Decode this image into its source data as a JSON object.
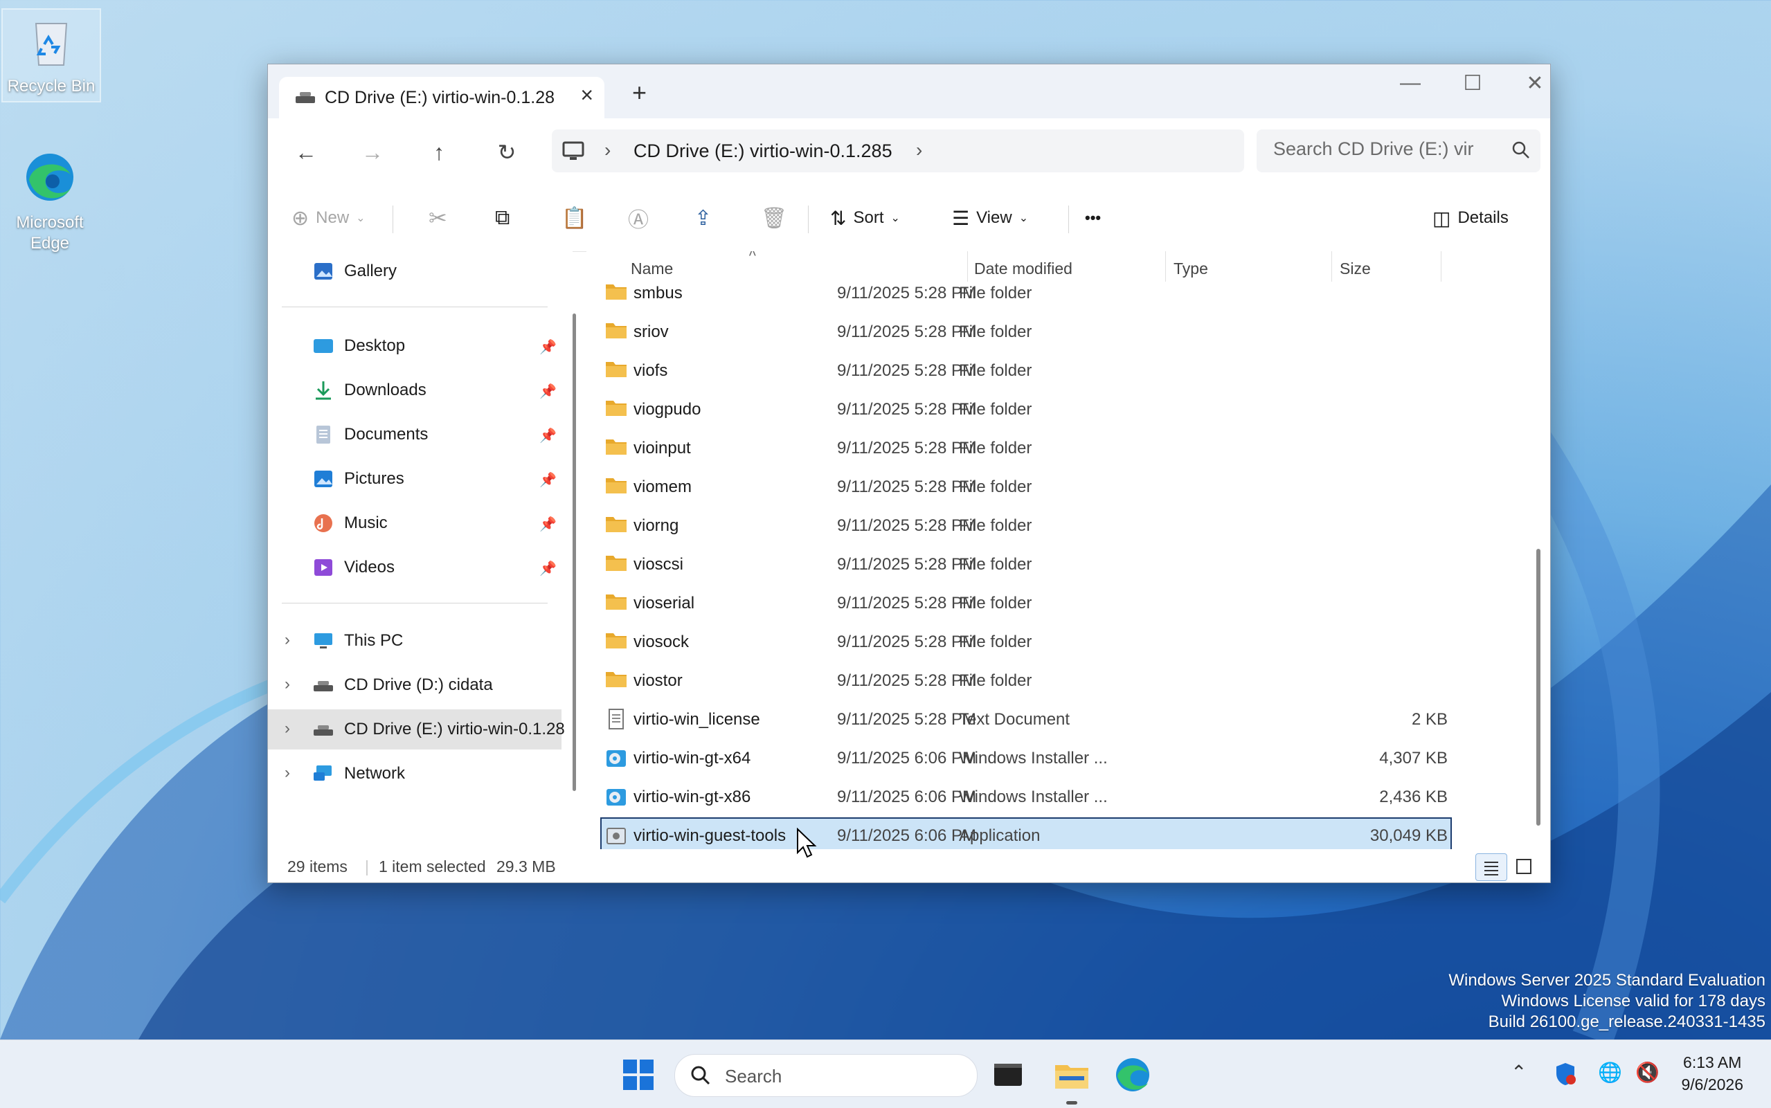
{
  "desktop": {
    "icons": [
      {
        "label": "Recycle Bin"
      },
      {
        "label": "Microsoft Edge"
      }
    ]
  },
  "window": {
    "tab_title": "CD Drive (E:) virtio-win-0.1.28",
    "address_path": "CD Drive (E:) virtio-win-0.1.285",
    "search_placeholder": "Search CD Drive (E:) vir",
    "toolbar": {
      "new": "New",
      "sort": "Sort",
      "view": "View",
      "more": "•••",
      "details": "Details"
    },
    "nav": {
      "gallery": "Gallery",
      "quick": [
        {
          "label": "Desktop"
        },
        {
          "label": "Downloads"
        },
        {
          "label": "Documents"
        },
        {
          "label": "Pictures"
        },
        {
          "label": "Music"
        },
        {
          "label": "Videos"
        }
      ],
      "tree": [
        {
          "label": "This PC"
        },
        {
          "label": "CD Drive (D:) cidata"
        },
        {
          "label": "CD Drive (E:) virtio-win-0.1.28"
        },
        {
          "label": "Network"
        }
      ]
    },
    "columns": {
      "name": "Name",
      "date": "Date modified",
      "type": "Type",
      "size": "Size"
    },
    "files": [
      {
        "name": "smbus",
        "date": "9/11/2025 5:28 PM",
        "type": "File folder",
        "size": ""
      },
      {
        "name": "sriov",
        "date": "9/11/2025 5:28 PM",
        "type": "File folder",
        "size": ""
      },
      {
        "name": "viofs",
        "date": "9/11/2025 5:28 PM",
        "type": "File folder",
        "size": ""
      },
      {
        "name": "viogpudo",
        "date": "9/11/2025 5:28 PM",
        "type": "File folder",
        "size": ""
      },
      {
        "name": "vioinput",
        "date": "9/11/2025 5:28 PM",
        "type": "File folder",
        "size": ""
      },
      {
        "name": "viomem",
        "date": "9/11/2025 5:28 PM",
        "type": "File folder",
        "size": ""
      },
      {
        "name": "viorng",
        "date": "9/11/2025 5:28 PM",
        "type": "File folder",
        "size": ""
      },
      {
        "name": "vioscsi",
        "date": "9/11/2025 5:28 PM",
        "type": "File folder",
        "size": ""
      },
      {
        "name": "vioserial",
        "date": "9/11/2025 5:28 PM",
        "type": "File folder",
        "size": ""
      },
      {
        "name": "viosock",
        "date": "9/11/2025 5:28 PM",
        "type": "File folder",
        "size": ""
      },
      {
        "name": "viostor",
        "date": "9/11/2025 5:28 PM",
        "type": "File folder",
        "size": ""
      },
      {
        "name": "virtio-win_license",
        "date": "9/11/2025 5:28 PM",
        "type": "Text Document",
        "size": "2 KB"
      },
      {
        "name": "virtio-win-gt-x64",
        "date": "9/11/2025 6:06 PM",
        "type": "Windows Installer ...",
        "size": "4,307 KB"
      },
      {
        "name": "virtio-win-gt-x86",
        "date": "9/11/2025 6:06 PM",
        "type": "Windows Installer ...",
        "size": "2,436 KB"
      },
      {
        "name": "virtio-win-guest-tools",
        "date": "9/11/2025 6:06 PM",
        "type": "Application",
        "size": "30,049 KB"
      }
    ],
    "status": {
      "items": "29 items",
      "selected": "1 item selected",
      "selected_size": "29.3 MB"
    }
  },
  "watermark": {
    "line1": "Windows Server 2025 Standard Evaluation",
    "line2": "Windows License valid for 178 days",
    "line3": "Build 26100.ge_release.240331-1435"
  },
  "taskbar": {
    "search": "Search",
    "time": "6:13 AM",
    "date": "9/6/2026"
  },
  "colors": {
    "accent": "#0067c0",
    "selection": "#cce4f7",
    "folder": "#f4c04e"
  }
}
